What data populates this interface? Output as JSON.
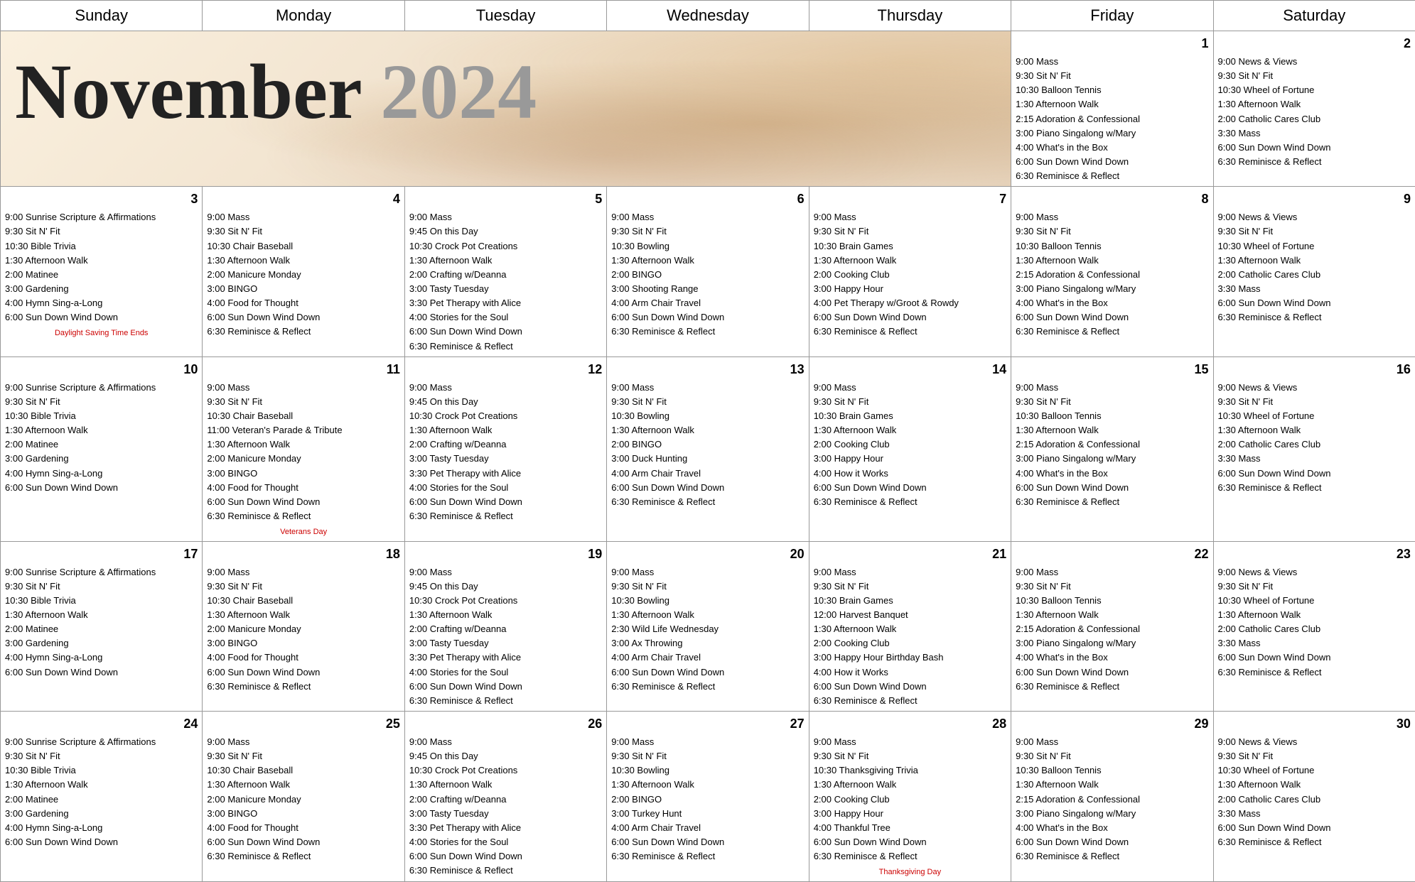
{
  "title": "November 2024",
  "month": "November",
  "year": "2024",
  "days_of_week": [
    "Sunday",
    "Monday",
    "Tuesday",
    "Wednesday",
    "Thursday",
    "Friday",
    "Saturday"
  ],
  "weeks": [
    {
      "days": [
        {
          "num": "",
          "empty": true,
          "events": []
        },
        {
          "num": "",
          "empty": true,
          "events": []
        },
        {
          "num": "",
          "empty": true,
          "events": []
        },
        {
          "num": "",
          "empty": true,
          "events": []
        },
        {
          "num": "",
          "empty": true,
          "events": []
        },
        {
          "num": "1",
          "empty": false,
          "events": [
            "9:00 Mass",
            "9:30 Sit N' Fit",
            "10:30 Balloon Tennis",
            "1:30 Afternoon Walk",
            "2:15 Adoration & Confessional",
            "3:00 Piano Singalong w/Mary",
            "4:00 What's in the Box",
            "6:00 Sun Down Wind Down",
            "6:30 Reminisce & Reflect"
          ]
        },
        {
          "num": "2",
          "empty": false,
          "events": [
            "9:00 News & Views",
            "9:30 Sit N' Fit",
            "10:30 Wheel of Fortune",
            "1:30 Afternoon Walk",
            "2:00 Catholic Cares Club",
            "3:30 Mass",
            "6:00 Sun Down Wind Down",
            "6:30 Reminisce & Reflect"
          ]
        }
      ]
    },
    {
      "special": {
        "day_idx": 0,
        "text": "Daylight Saving Time Ends"
      },
      "days": [
        {
          "num": "3",
          "empty": false,
          "events": [
            "9:00 Sunrise Scripture & Affirmations",
            "9:30 Sit N' Fit",
            "10:30 Bible Trivia",
            "1:30 Afternoon Walk",
            "2:00 Matinee",
            "3:00 Gardening",
            "4:00 Hymn Sing-a-Long",
            "6:00 Sun Down Wind Down"
          ]
        },
        {
          "num": "4",
          "empty": false,
          "events": [
            "9:00 Mass",
            "9:30 Sit N' Fit",
            "10:30 Chair Baseball",
            "1:30 Afternoon Walk",
            "2:00 Manicure Monday",
            "3:00 BINGO",
            "4:00 Food for Thought",
            "6:00 Sun Down Wind Down",
            "6:30 Reminisce & Reflect"
          ]
        },
        {
          "num": "5",
          "empty": false,
          "events": [
            "9:00 Mass",
            "9:45 On this Day",
            "10:30 Crock Pot Creations",
            "1:30 Afternoon Walk",
            "2:00 Crafting w/Deanna",
            "3:00 Tasty Tuesday",
            "3:30 Pet Therapy with Alice",
            "4:00 Stories for the Soul",
            "6:00 Sun Down Wind Down",
            "6:30 Reminisce & Reflect"
          ]
        },
        {
          "num": "6",
          "empty": false,
          "events": [
            "9:00 Mass",
            "9:30 Sit N' Fit",
            "10:30 Bowling",
            "1:30 Afternoon Walk",
            "2:00 BINGO",
            "3:00 Shooting Range",
            "4:00 Arm Chair Travel",
            "6:00 Sun Down Wind Down",
            "6:30 Reminisce & Reflect"
          ]
        },
        {
          "num": "7",
          "empty": false,
          "events": [
            "9:00 Mass",
            "9:30 Sit N' Fit",
            "10:30 Brain Games",
            "1:30 Afternoon Walk",
            "2:00 Cooking Club",
            "3:00 Happy Hour",
            "4:00 Pet Therapy w/Groot & Rowdy",
            "6:00 Sun Down Wind Down",
            "6:30 Reminisce & Reflect"
          ]
        },
        {
          "num": "8",
          "empty": false,
          "events": [
            "9:00 Mass",
            "9:30 Sit N' Fit",
            "10:30 Balloon Tennis",
            "1:30 Afternoon Walk",
            "2:15 Adoration & Confessional",
            "3:00 Piano Singalong w/Mary",
            "4:00 What's in the Box",
            "6:00 Sun Down Wind Down",
            "6:30 Reminisce & Reflect"
          ]
        },
        {
          "num": "9",
          "empty": false,
          "events": [
            "9:00 News & Views",
            "9:30 Sit N' Fit",
            "10:30 Wheel of Fortune",
            "1:30 Afternoon Walk",
            "2:00 Catholic Cares Club",
            "3:30 Mass",
            "6:00 Sun Down Wind Down",
            "6:30 Reminisce & Reflect"
          ]
        }
      ]
    },
    {
      "special": {
        "day_idx": 1,
        "text": "Veterans Day"
      },
      "days": [
        {
          "num": "10",
          "empty": false,
          "events": [
            "9:00 Sunrise Scripture & Affirmations",
            "9:30 Sit N' Fit",
            "10:30 Bible Trivia",
            "1:30 Afternoon Walk",
            "2:00 Matinee",
            "3:00 Gardening",
            "4:00 Hymn Sing-a-Long",
            "6:00 Sun Down Wind Down"
          ]
        },
        {
          "num": "11",
          "empty": false,
          "events": [
            "9:00 Mass",
            "9:30 Sit N' Fit",
            "10:30 Chair Baseball",
            "11:00 Veteran's Parade & Tribute",
            "1:30 Afternoon Walk",
            "2:00 Manicure Monday",
            "3:00 BINGO",
            "4:00 Food for Thought",
            "6:00 Sun Down Wind Down",
            "6:30 Reminisce & Reflect"
          ]
        },
        {
          "num": "12",
          "empty": false,
          "events": [
            "9:00 Mass",
            "9:45 On this Day",
            "10:30 Crock Pot Creations",
            "1:30 Afternoon Walk",
            "2:00 Crafting w/Deanna",
            "3:00 Tasty Tuesday",
            "3:30 Pet Therapy with Alice",
            "4:00 Stories for the Soul",
            "6:00 Sun Down Wind Down",
            "6:30 Reminisce & Reflect"
          ]
        },
        {
          "num": "13",
          "empty": false,
          "events": [
            "9:00 Mass",
            "9:30 Sit N' Fit",
            "10:30 Bowling",
            "1:30 Afternoon Walk",
            "2:00 BINGO",
            "3:00 Duck Hunting",
            "4:00 Arm Chair Travel",
            "6:00 Sun Down Wind Down",
            "6:30 Reminisce & Reflect"
          ]
        },
        {
          "num": "14",
          "empty": false,
          "events": [
            "9:00 Mass",
            "9:30 Sit N' Fit",
            "10:30 Brain Games",
            "1:30 Afternoon Walk",
            "2:00 Cooking Club",
            "3:00 Happy Hour",
            "4:00 How it Works",
            "6:00 Sun Down Wind Down",
            "6:30 Reminisce & Reflect"
          ]
        },
        {
          "num": "15",
          "empty": false,
          "events": [
            "9:00 Mass",
            "9:30 Sit N' Fit",
            "10:30 Balloon Tennis",
            "1:30 Afternoon Walk",
            "2:15 Adoration & Confessional",
            "3:00 Piano Singalong w/Mary",
            "4:00 What's in the Box",
            "6:00 Sun Down Wind Down",
            "6:30 Reminisce & Reflect"
          ]
        },
        {
          "num": "16",
          "empty": false,
          "events": [
            "9:00 News & Views",
            "9:30 Sit N' Fit",
            "10:30 Wheel of Fortune",
            "1:30 Afternoon Walk",
            "2:00 Catholic Cares Club",
            "3:30 Mass",
            "6:00 Sun Down Wind Down",
            "6:30 Reminisce & Reflect"
          ]
        }
      ]
    },
    {
      "days": [
        {
          "num": "17",
          "empty": false,
          "events": [
            "9:00 Sunrise Scripture & Affirmations",
            "9:30 Sit N' Fit",
            "10:30 Bible Trivia",
            "1:30 Afternoon Walk",
            "2:00 Matinee",
            "3:00 Gardening",
            "4:00 Hymn Sing-a-Long",
            "6:00 Sun Down Wind Down"
          ]
        },
        {
          "num": "18",
          "empty": false,
          "events": [
            "9:00 Mass",
            "9:30 Sit N' Fit",
            "10:30 Chair Baseball",
            "1:30 Afternoon Walk",
            "2:00 Manicure Monday",
            "3:00 BINGO",
            "4:00 Food for Thought",
            "6:00 Sun Down Wind Down",
            "6:30 Reminisce & Reflect"
          ]
        },
        {
          "num": "19",
          "empty": false,
          "events": [
            "9:00 Mass",
            "9:45 On this Day",
            "10:30 Crock Pot Creations",
            "1:30 Afternoon Walk",
            "2:00 Crafting w/Deanna",
            "3:00 Tasty Tuesday",
            "3:30 Pet Therapy with Alice",
            "4:00 Stories for the Soul",
            "6:00 Sun Down Wind Down",
            "6:30 Reminisce & Reflect"
          ]
        },
        {
          "num": "20",
          "empty": false,
          "events": [
            "9:00 Mass",
            "9:30 Sit N' Fit",
            "10:30 Bowling",
            "1:30 Afternoon Walk",
            "2:30 Wild Life Wednesday",
            "3:00 Ax Throwing",
            "4:00 Arm Chair Travel",
            "6:00 Sun Down Wind Down",
            "6:30 Reminisce & Reflect"
          ]
        },
        {
          "num": "21",
          "empty": false,
          "events": [
            "9:00 Mass",
            "9:30 Sit N' Fit",
            "10:30 Brain Games",
            "12:00 Harvest Banquet",
            "1:30 Afternoon Walk",
            "2:00 Cooking Club",
            "3:00 Happy Hour Birthday Bash",
            "4:00 How it Works",
            "6:00 Sun Down Wind Down",
            "6:30 Reminisce & Reflect"
          ]
        },
        {
          "num": "22",
          "empty": false,
          "events": [
            "9:00 Mass",
            "9:30 Sit N' Fit",
            "10:30 Balloon Tennis",
            "1:30 Afternoon Walk",
            "2:15 Adoration & Confessional",
            "3:00 Piano Singalong w/Mary",
            "4:00 What's in the Box",
            "6:00 Sun Down Wind Down",
            "6:30 Reminisce & Reflect"
          ]
        },
        {
          "num": "23",
          "empty": false,
          "events": [
            "9:00 News & Views",
            "9:30 Sit N' Fit",
            "10:30 Wheel of Fortune",
            "1:30 Afternoon Walk",
            "2:00 Catholic Cares Club",
            "3:30 Mass",
            "6:00 Sun Down Wind Down",
            "6:30 Reminisce & Reflect"
          ]
        }
      ]
    },
    {
      "special": {
        "day_idx": 4,
        "text": "Thanksgiving Day"
      },
      "days": [
        {
          "num": "24",
          "empty": false,
          "events": [
            "9:00 Sunrise Scripture & Affirmations",
            "9:30 Sit N' Fit",
            "10:30 Bible Trivia",
            "1:30 Afternoon Walk",
            "2:00 Matinee",
            "3:00 Gardening",
            "4:00 Hymn Sing-a-Long",
            "6:00 Sun Down Wind Down"
          ]
        },
        {
          "num": "25",
          "empty": false,
          "events": [
            "9:00 Mass",
            "9:30 Sit N' Fit",
            "10:30 Chair Baseball",
            "1:30 Afternoon Walk",
            "2:00 Manicure Monday",
            "3:00 BINGO",
            "4:00 Food for Thought",
            "6:00 Sun Down Wind Down",
            "6:30 Reminisce & Reflect"
          ]
        },
        {
          "num": "26",
          "empty": false,
          "events": [
            "9:00 Mass",
            "9:45 On this Day",
            "10:30 Crock Pot Creations",
            "1:30 Afternoon Walk",
            "2:00 Crafting w/Deanna",
            "3:00 Tasty Tuesday",
            "3:30 Pet Therapy with Alice",
            "4:00 Stories for the Soul",
            "6:00 Sun Down Wind Down",
            "6:30 Reminisce & Reflect"
          ]
        },
        {
          "num": "27",
          "empty": false,
          "events": [
            "9:00 Mass",
            "9:30 Sit N' Fit",
            "10:30 Bowling",
            "1:30 Afternoon Walk",
            "2:00 BINGO",
            "3:00 Turkey Hunt",
            "4:00 Arm Chair Travel",
            "6:00 Sun Down Wind Down",
            "6:30 Reminisce & Reflect"
          ]
        },
        {
          "num": "28",
          "empty": false,
          "events": [
            "9:00 Mass",
            "9:30 Sit N' Fit",
            "10:30 Thanksgiving Trivia",
            "1:30 Afternoon Walk",
            "2:00 Cooking Club",
            "3:00 Happy Hour",
            "4:00 Thankful Tree",
            "6:00 Sun Down Wind Down",
            "6:30 Reminisce & Reflect"
          ]
        },
        {
          "num": "29",
          "empty": false,
          "events": [
            "9:00 Mass",
            "9:30 Sit N' Fit",
            "10:30 Balloon Tennis",
            "1:30 Afternoon Walk",
            "2:15 Adoration & Confessional",
            "3:00 Piano Singalong w/Mary",
            "4:00 What's in the Box",
            "6:00 Sun Down Wind Down",
            "6:30 Reminisce & Reflect"
          ]
        },
        {
          "num": "30",
          "empty": false,
          "events": [
            "9:00 News & Views",
            "9:30 Sit N' Fit",
            "10:30 Wheel of Fortune",
            "1:30 Afternoon Walk",
            "2:00 Catholic Cares Club",
            "3:30 Mass",
            "6:00 Sun Down Wind Down",
            "6:30 Reminisce & Reflect"
          ]
        }
      ]
    }
  ]
}
